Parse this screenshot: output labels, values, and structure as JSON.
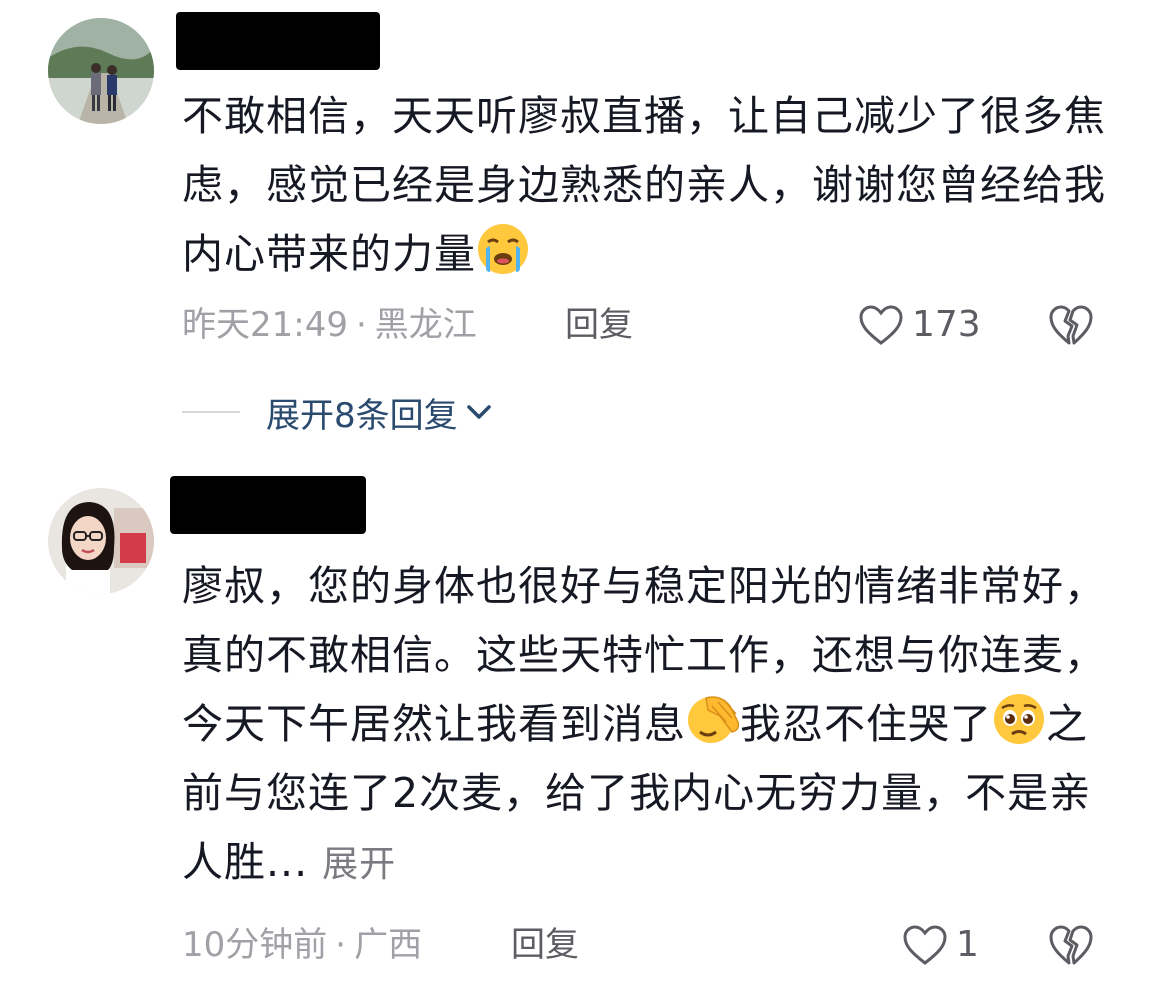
{
  "comments": [
    {
      "avatar_icon": "avatar-couple-walking",
      "username": "",
      "text_before_emoji": "不敢相信，天天听廖叔直播，让自己减少了很多焦虑，感觉已经是身边熟悉的亲人，谢谢您曾经给我内心带来的力量",
      "emoji": "crying-face-emoji",
      "time": "昨天21:49",
      "separator": "·",
      "location": "黑龙江",
      "reply_label": "回复",
      "like_count": "173"
    },
    {
      "avatar_icon": "avatar-woman-glasses",
      "username": "",
      "text_part1": "廖叔，您的身体也很好与稳定阳光的情绪非常好，真的不敢相信。这些天特忙工作，还想与你连麦，今天下午居然让我看到消息",
      "emoji1": "facepalm-emoji",
      "text_part2": "我忍不住哭了",
      "emoji2": "pleading-face-emoji",
      "text_part3": "之前与您连了2次麦，给了我内心无穷力量，不是亲人胜...",
      "more_label": "展开",
      "time": "10分钟前",
      "separator": "·",
      "location": "广西",
      "reply_label": "回复",
      "like_count": "1"
    }
  ],
  "expand_replies": {
    "label": "展开8条回复"
  },
  "colors": {
    "text": "#161823",
    "meta": "#a0a0a6",
    "link": "#2a4a6e",
    "redaction": "#000000"
  }
}
